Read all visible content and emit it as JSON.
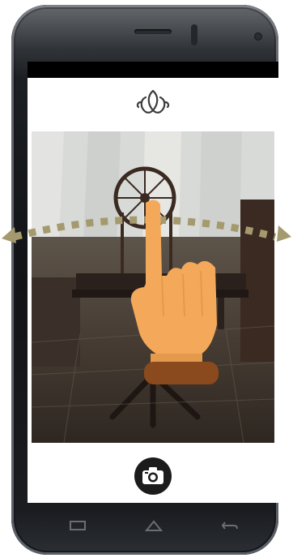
{
  "app": {
    "logo_icon": "lotus-leaf-icon",
    "shutter_icon": "camera-icon"
  },
  "photo": {
    "subject": "photo-preview"
  },
  "gesture": {
    "hand_icon": "pointing-hand-icon",
    "swipe_direction": "horizontal",
    "dot_color": "#a49a6e"
  },
  "navigation": {
    "items": [
      {
        "name": "recent-apps-icon"
      },
      {
        "name": "home-icon"
      },
      {
        "name": "back-icon"
      }
    ]
  },
  "colors": {
    "skin": "#f4a95a",
    "cuff": "#8b4a1e",
    "phone_body": "#16181b",
    "logo": "#3c3c3c"
  }
}
